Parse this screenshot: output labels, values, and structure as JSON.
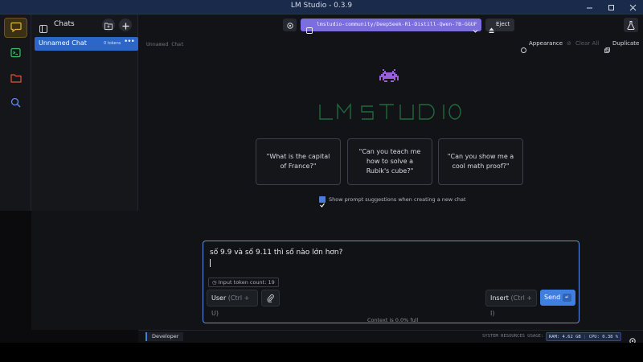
{
  "window": {
    "title": "LM Studio - 0.3.9"
  },
  "sidebar": {
    "items": [
      {
        "icon": "chat-bubble-icon"
      },
      {
        "icon": "terminal-icon"
      },
      {
        "icon": "folder-icon"
      },
      {
        "icon": "search-icon"
      }
    ]
  },
  "chats": {
    "label": "Chats",
    "items": [
      {
        "name": "Unnamed Chat",
        "tokens": "0 tokens",
        "menu": "•••"
      }
    ]
  },
  "header": {
    "model": "lmstudio-community/DeepSeek-R1-Distill-Qwen-7B-GGUF",
    "eject": "Eject",
    "chat_title": "Unnamed Chat",
    "appearance": "Appearance",
    "clear_all": "Clear All",
    "duplicate": "Duplicate"
  },
  "suggestions": [
    "\"What is the capital of France?\"",
    "\"Can you teach me how to solve a Rubik's cube?\"",
    "\"Can you show me a cool math proof?\""
  ],
  "show_suggestions": {
    "label": "Show prompt suggestions when creating a new chat",
    "checked": true
  },
  "composer": {
    "text": "số 9.9 và số 9.11 thì số nào lớn hơn?",
    "token_count": "Input token count: 19",
    "user_label": "User",
    "user_shortcut": "(Ctrl + U)",
    "insert_label": "Insert",
    "insert_shortcut": "(Ctrl + I)",
    "send_label": "Send",
    "send_key": "↵"
  },
  "context": "Context is 0.0% full",
  "statusbar": {
    "developer": "Developer",
    "system_label": "SYSTEM RESOURCES USAGE:",
    "ram": "RAM: 4.62 GB",
    "cpu": "CPU: 0.38 %"
  },
  "colors": {
    "accent": "#3f7fe0",
    "model_pill": "#7b6fe0",
    "active_rail": "#c9a227"
  }
}
